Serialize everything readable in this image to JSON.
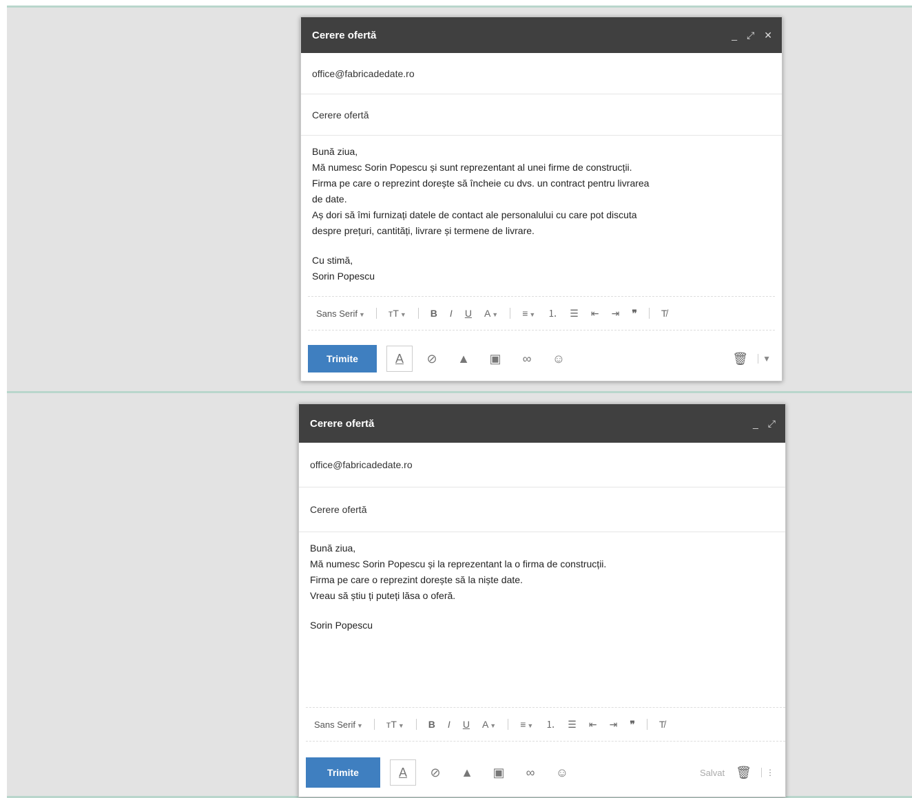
{
  "compose1": {
    "title": "Cerere ofertă",
    "minimize": "_",
    "expand": "⤢",
    "close": "✕",
    "to": "office@fabricadedate.ro",
    "subject": "Cerere ofertă",
    "body": [
      "Bună ziua,",
      "Mă numesc Sorin Popescu și sunt reprezentant al unei firme de construcții.",
      "Firma pe care o reprezint dorește să încheie cu dvs. un contract pentru livrarea",
      "de date.",
      "Aș dori să îmi furnizați datele de contact ale personalului cu care pot discuta",
      "despre prețuri, cantități, livrare și termene de livrare.",
      "",
      "Cu stimă,",
      "Sorin Popescu"
    ],
    "font_label": "Sans Serif",
    "send_label": "Trimite"
  },
  "compose2": {
    "title": "Cerere ofertă",
    "minimize": "_",
    "expand": "⤢",
    "to": "office@fabricadedate.ro",
    "subject": "Cerere ofertă",
    "body": [
      "Bună ziua,",
      "Mă numesc Sorin Popescu și la reprezentant la o firma de construcții.",
      "Firma pe care o reprezint dorește să la niște date.",
      "Vreau să știu ți puteți lăsa o oferă.",
      "",
      "Sorin Popescu"
    ],
    "font_label": "Sans Serif",
    "send_label": "Trimite",
    "draft_label": "Salvat"
  },
  "toolbar_icons": [
    "text-size-icon",
    "bold-icon",
    "italic-icon",
    "underline-icon",
    "text-color-icon",
    "align-icon",
    "numbered-list-icon",
    "bulleted-list-icon",
    "indent-less-icon",
    "indent-more-icon",
    "quote-icon",
    "remove-formatting-icon"
  ],
  "bottom_icons": [
    "formatting-icon",
    "attach-icon",
    "drive-icon",
    "photo-icon",
    "link-icon",
    "emoji-icon"
  ],
  "colors": {
    "titlebar": "#404040",
    "send_button": "#3f7fc0",
    "panel_background": "#e3e3e3",
    "panel_border": "#b9d6cc"
  }
}
